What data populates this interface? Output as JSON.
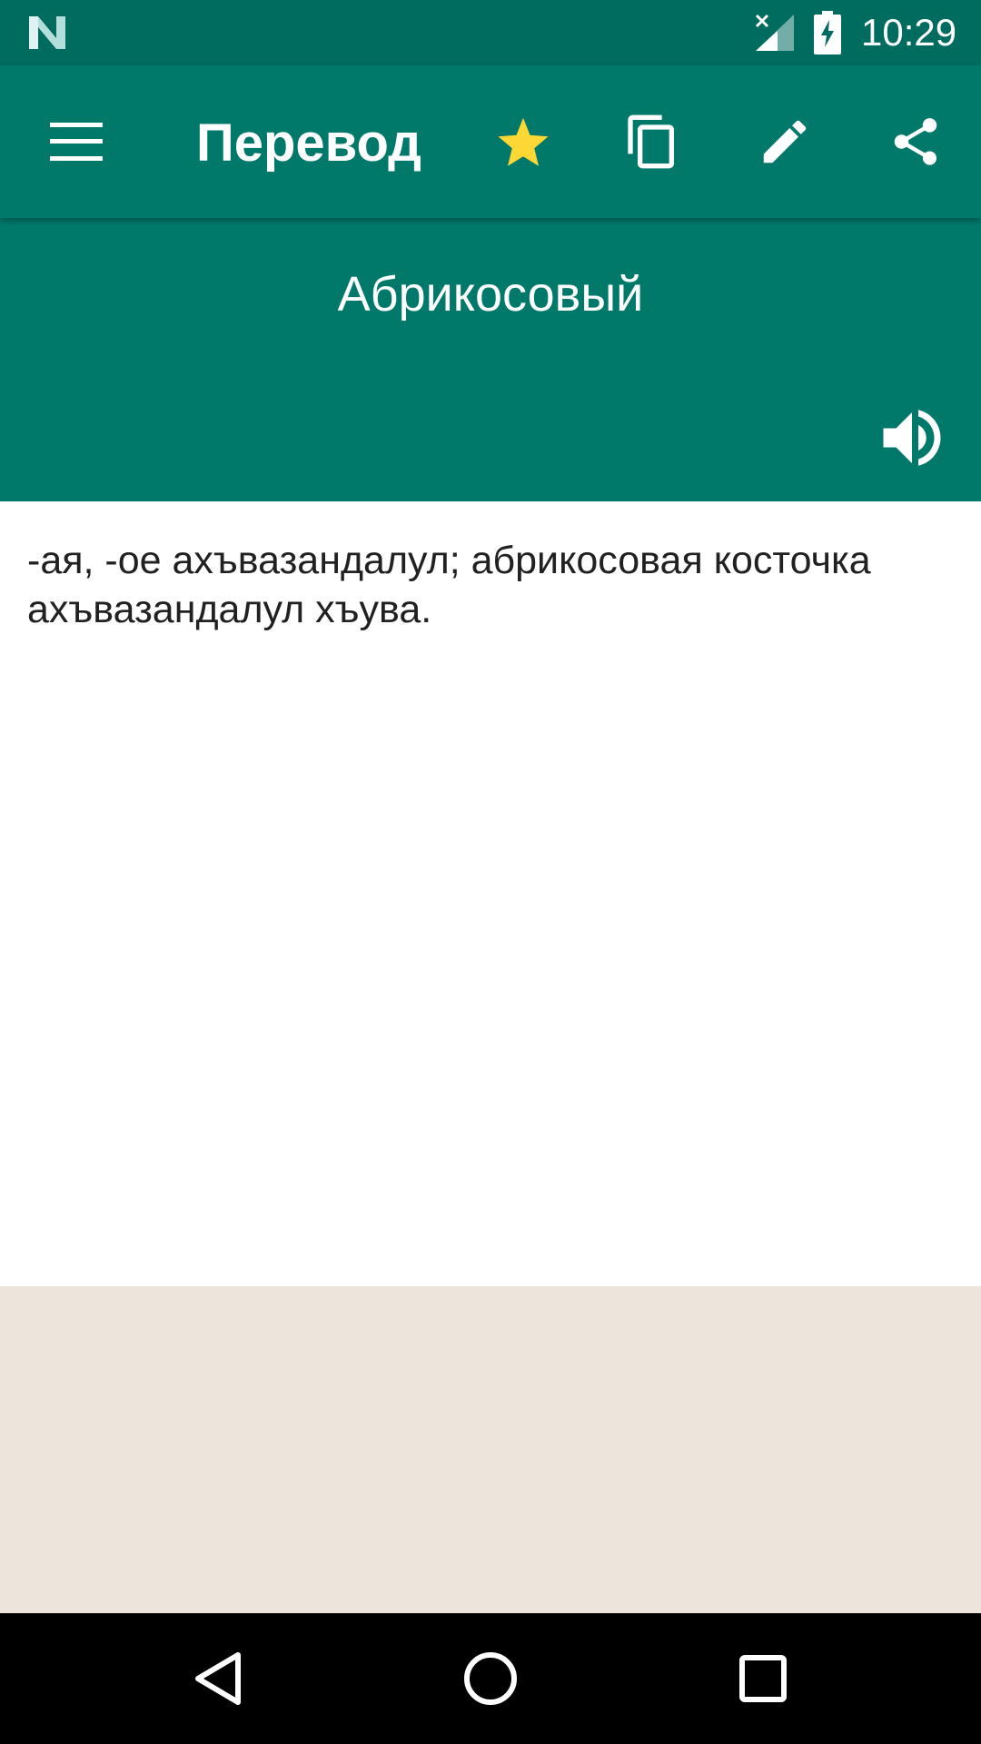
{
  "status_bar": {
    "time": "10:29",
    "icons": [
      "notification-n-icon",
      "signal-icon",
      "battery-charging-icon"
    ]
  },
  "app_bar": {
    "title": "Перевод",
    "icons": [
      "menu-icon",
      "star-icon",
      "copy-icon",
      "edit-icon",
      "share-icon"
    ]
  },
  "header": {
    "word": "Абрикосовый",
    "icon": "speaker-icon"
  },
  "content": {
    "translation": "-ая, -ое ахъвазандалул; абрикосовая косточка ахъвазандалул хъува."
  },
  "nav_bar": {
    "icons": [
      "back-icon",
      "home-icon",
      "recents-icon"
    ]
  },
  "colors": {
    "primary": "#00796b",
    "primary_dark": "#006b5f",
    "accent_star": "#fdd835",
    "ad_background": "#ede4db"
  }
}
